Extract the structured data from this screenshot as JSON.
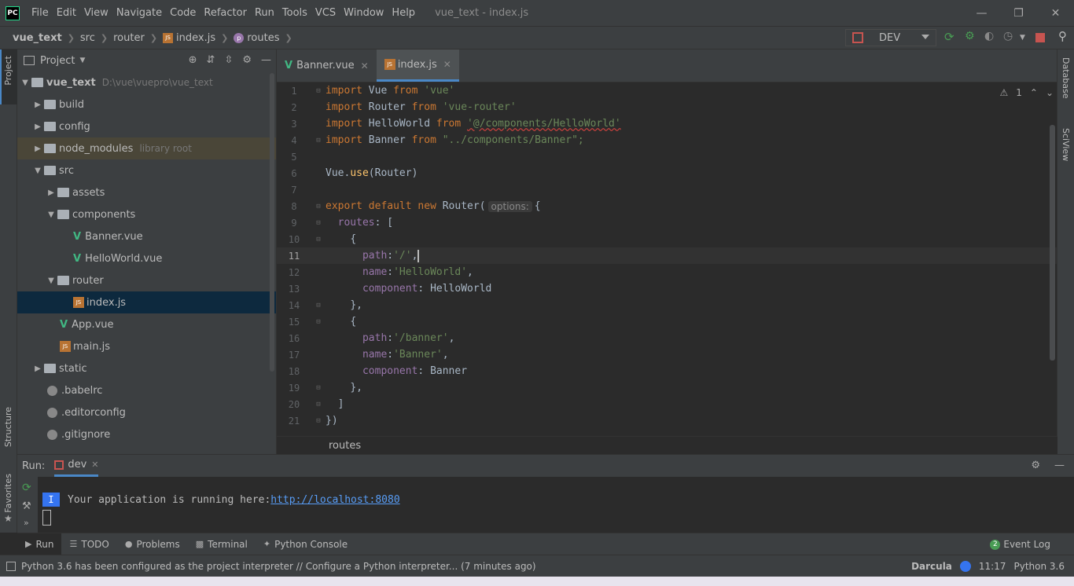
{
  "titlebar": {
    "logo": "PC",
    "menu": [
      "File",
      "Edit",
      "View",
      "Navigate",
      "Code",
      "Refactor",
      "Run",
      "Tools",
      "VCS",
      "Window",
      "Help"
    ],
    "window_title": "vue_text - index.js"
  },
  "navbar": {
    "crumbs": [
      "vue_text",
      "src",
      "router",
      "index.js",
      "routes"
    ],
    "run_config": "DEV"
  },
  "left_strip": {
    "project": "Project",
    "structure": "Structure",
    "favorites": "Favorites"
  },
  "right_strip": {
    "database": "Database",
    "sciview": "SciView"
  },
  "project": {
    "header": "Project",
    "tree": [
      {
        "label": "vue_text",
        "path": "D:\\vue\\vuepro\\vue_text"
      },
      {
        "label": "build"
      },
      {
        "label": "config"
      },
      {
        "label": "node_modules",
        "note": "library root"
      },
      {
        "label": "src"
      },
      {
        "label": "assets"
      },
      {
        "label": "components"
      },
      {
        "label": "Banner.vue"
      },
      {
        "label": "HelloWorld.vue"
      },
      {
        "label": "router"
      },
      {
        "label": "index.js"
      },
      {
        "label": "App.vue"
      },
      {
        "label": "main.js"
      },
      {
        "label": "static"
      },
      {
        "label": ".babelrc"
      },
      {
        "label": ".editorconfig"
      },
      {
        "label": ".gitignore"
      }
    ]
  },
  "editor": {
    "tabs": [
      "Banner.vue",
      "index.js"
    ],
    "warnings": "1",
    "line_numbers": [
      "1",
      "2",
      "3",
      "4",
      "5",
      "6",
      "7",
      "8",
      "9",
      "10",
      "11",
      "12",
      "13",
      "14",
      "15",
      "16",
      "17",
      "18",
      "19",
      "20",
      "21"
    ],
    "code": {
      "l1": [
        "import",
        "Vue",
        "from",
        "'vue'"
      ],
      "l2": [
        "import",
        "Router",
        "from",
        "'vue-router'"
      ],
      "l3": [
        "import",
        "HelloWorld",
        "from",
        "'@/components/HelloWorld'"
      ],
      "l4": [
        "import",
        "Banner",
        "from",
        "\"../components/Banner\";"
      ],
      "l6": [
        "Vue.",
        "use",
        "(Router)"
      ],
      "l8": [
        "export",
        "default",
        "new",
        "Router(",
        "options:",
        "{"
      ],
      "l9": [
        "routes",
        ": ["
      ],
      "l10": "{",
      "l11": [
        "path",
        ": ",
        "'/'",
        ","
      ],
      "l12": [
        "name",
        ": ",
        "'HelloWorld'",
        ","
      ],
      "l13": [
        "component",
        ": HelloWorld"
      ],
      "l14": "},",
      "l15": "{",
      "l16": [
        "path",
        ": ",
        "'/banner'",
        ","
      ],
      "l17": [
        "name",
        ": ",
        "'Banner'",
        ","
      ],
      "l18": [
        "component",
        ": Banner"
      ],
      "l19": "},",
      "l20": "]",
      "l21": "})"
    },
    "breadcrumb": "routes"
  },
  "run": {
    "label": "Run:",
    "tab": "dev",
    "badge": "I",
    "message": "Your application is running here: ",
    "url": "http://localhost:8080"
  },
  "bottom_tabs": [
    "Run",
    "TODO",
    "Problems",
    "Terminal",
    "Python Console"
  ],
  "event_log": {
    "count": "2",
    "label": "Event Log"
  },
  "status": {
    "message": "Python 3.6 has been configured as the project interpreter // Configure a Python interpreter... (7 minutes ago)",
    "theme": "Darcula",
    "time": "11:17",
    "interpreter": "Python 3.6"
  }
}
